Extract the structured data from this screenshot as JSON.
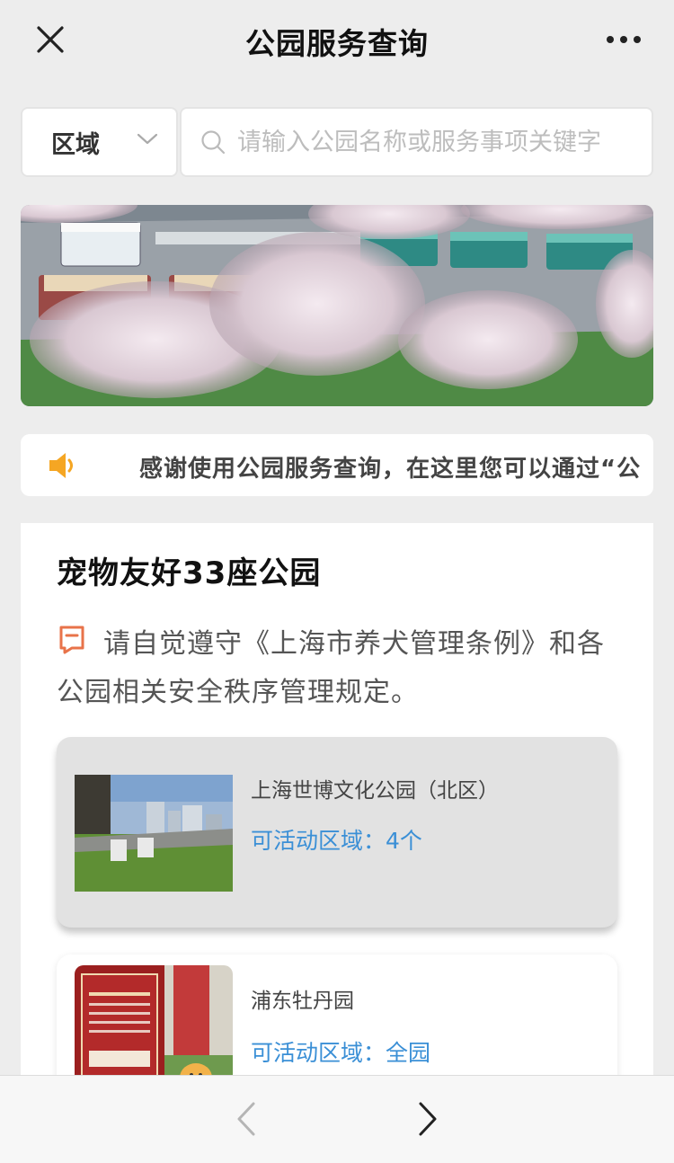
{
  "navbar": {
    "title": "公园服务查询",
    "close_icon": "close-icon",
    "more_icon": "more-dots-icon"
  },
  "search": {
    "region_label": "区域",
    "placeholder": "请输入公园名称或服务事项关键字"
  },
  "notice": {
    "icon": "speaker-icon",
    "text": "感谢使用公园服务查询，在这里您可以通过“公"
  },
  "section": {
    "title": "宠物友好33座公园",
    "tip": "请自觉遵守《上海市养犬管理条例》和各公园相关安全秩序管理规定。"
  },
  "parks": [
    {
      "name": "上海世博文化公园（北区）",
      "area": "可活动区域：4个"
    },
    {
      "name": "浦东牡丹园",
      "area": "可活动区域：全园"
    }
  ],
  "colors": {
    "accent_blue": "#3a8fd6",
    "notice_orange": "#f5a623",
    "tip_orange": "#e8734a",
    "background": "#ededed"
  }
}
